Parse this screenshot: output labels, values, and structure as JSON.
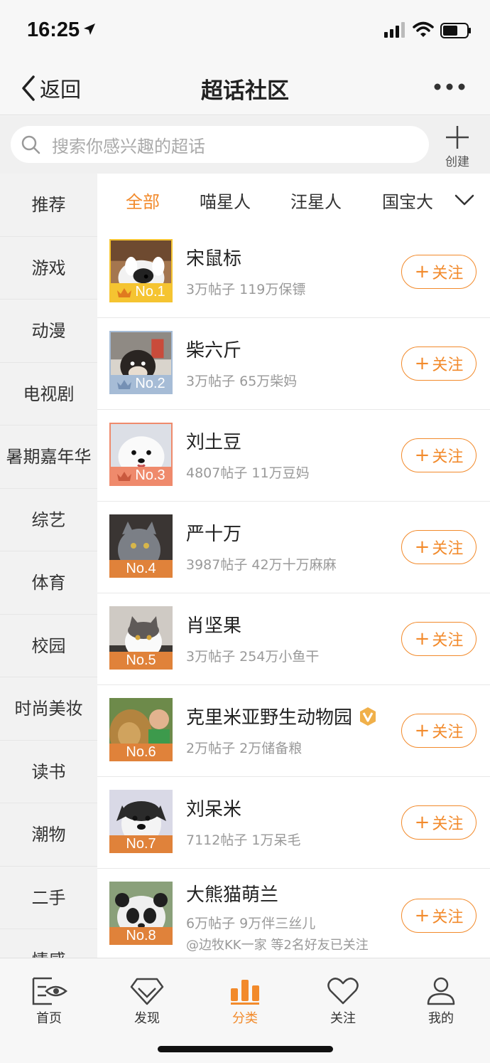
{
  "status_bar": {
    "time": "16:25"
  },
  "nav": {
    "back_label": "返回",
    "title": "超话社区"
  },
  "search": {
    "placeholder": "搜索你感兴趣的超话",
    "create_label": "创建"
  },
  "sidebar": {
    "items": [
      {
        "label": "推荐"
      },
      {
        "label": "游戏"
      },
      {
        "label": "动漫"
      },
      {
        "label": "电视剧"
      },
      {
        "label": "暑期嘉年华"
      },
      {
        "label": "综艺"
      },
      {
        "label": "体育"
      },
      {
        "label": "校园"
      },
      {
        "label": "时尚美妆"
      },
      {
        "label": "读书"
      },
      {
        "label": "潮物"
      },
      {
        "label": "二手"
      },
      {
        "label": "情感"
      }
    ]
  },
  "tabs": [
    {
      "label": "全部"
    },
    {
      "label": "喵星人"
    },
    {
      "label": "汪星人"
    },
    {
      "label": "国宝大"
    }
  ],
  "items": [
    {
      "rank": "No.1",
      "name": "宋鼠标",
      "meta": "3万帖子 119万保镖"
    },
    {
      "rank": "No.2",
      "name": "柴六斤",
      "meta": "3万帖子 65万柴妈"
    },
    {
      "rank": "No.3",
      "name": "刘土豆",
      "meta": "4807帖子 11万豆妈"
    },
    {
      "rank": "No.4",
      "name": "严十万",
      "meta": "3987帖子 42万十万麻麻"
    },
    {
      "rank": "No.5",
      "name": "肖坚果",
      "meta": "3万帖子 254万小鱼干"
    },
    {
      "rank": "No.6",
      "name": "克里米亚野生动物园",
      "meta": "2万帖子 2万储备粮"
    },
    {
      "rank": "No.7",
      "name": "刘呆米",
      "meta": "7112帖子 1万呆毛"
    },
    {
      "rank": "No.8",
      "name": "大熊猫萌兰",
      "meta": "6万帖子 9万伴三丝儿",
      "friends": "@边牧KK一家 等2名好友已关注"
    }
  ],
  "follow_label": "关注",
  "tabbar": [
    {
      "label": "首页"
    },
    {
      "label": "发现"
    },
    {
      "label": "分类"
    },
    {
      "label": "关注"
    },
    {
      "label": "我的"
    }
  ],
  "colors": {
    "accent": "#f28a2b",
    "gold": "#f5c431",
    "silver": "#a6bcd6",
    "bronze": "#ef8a6c",
    "rank_default": "#e0823a"
  }
}
